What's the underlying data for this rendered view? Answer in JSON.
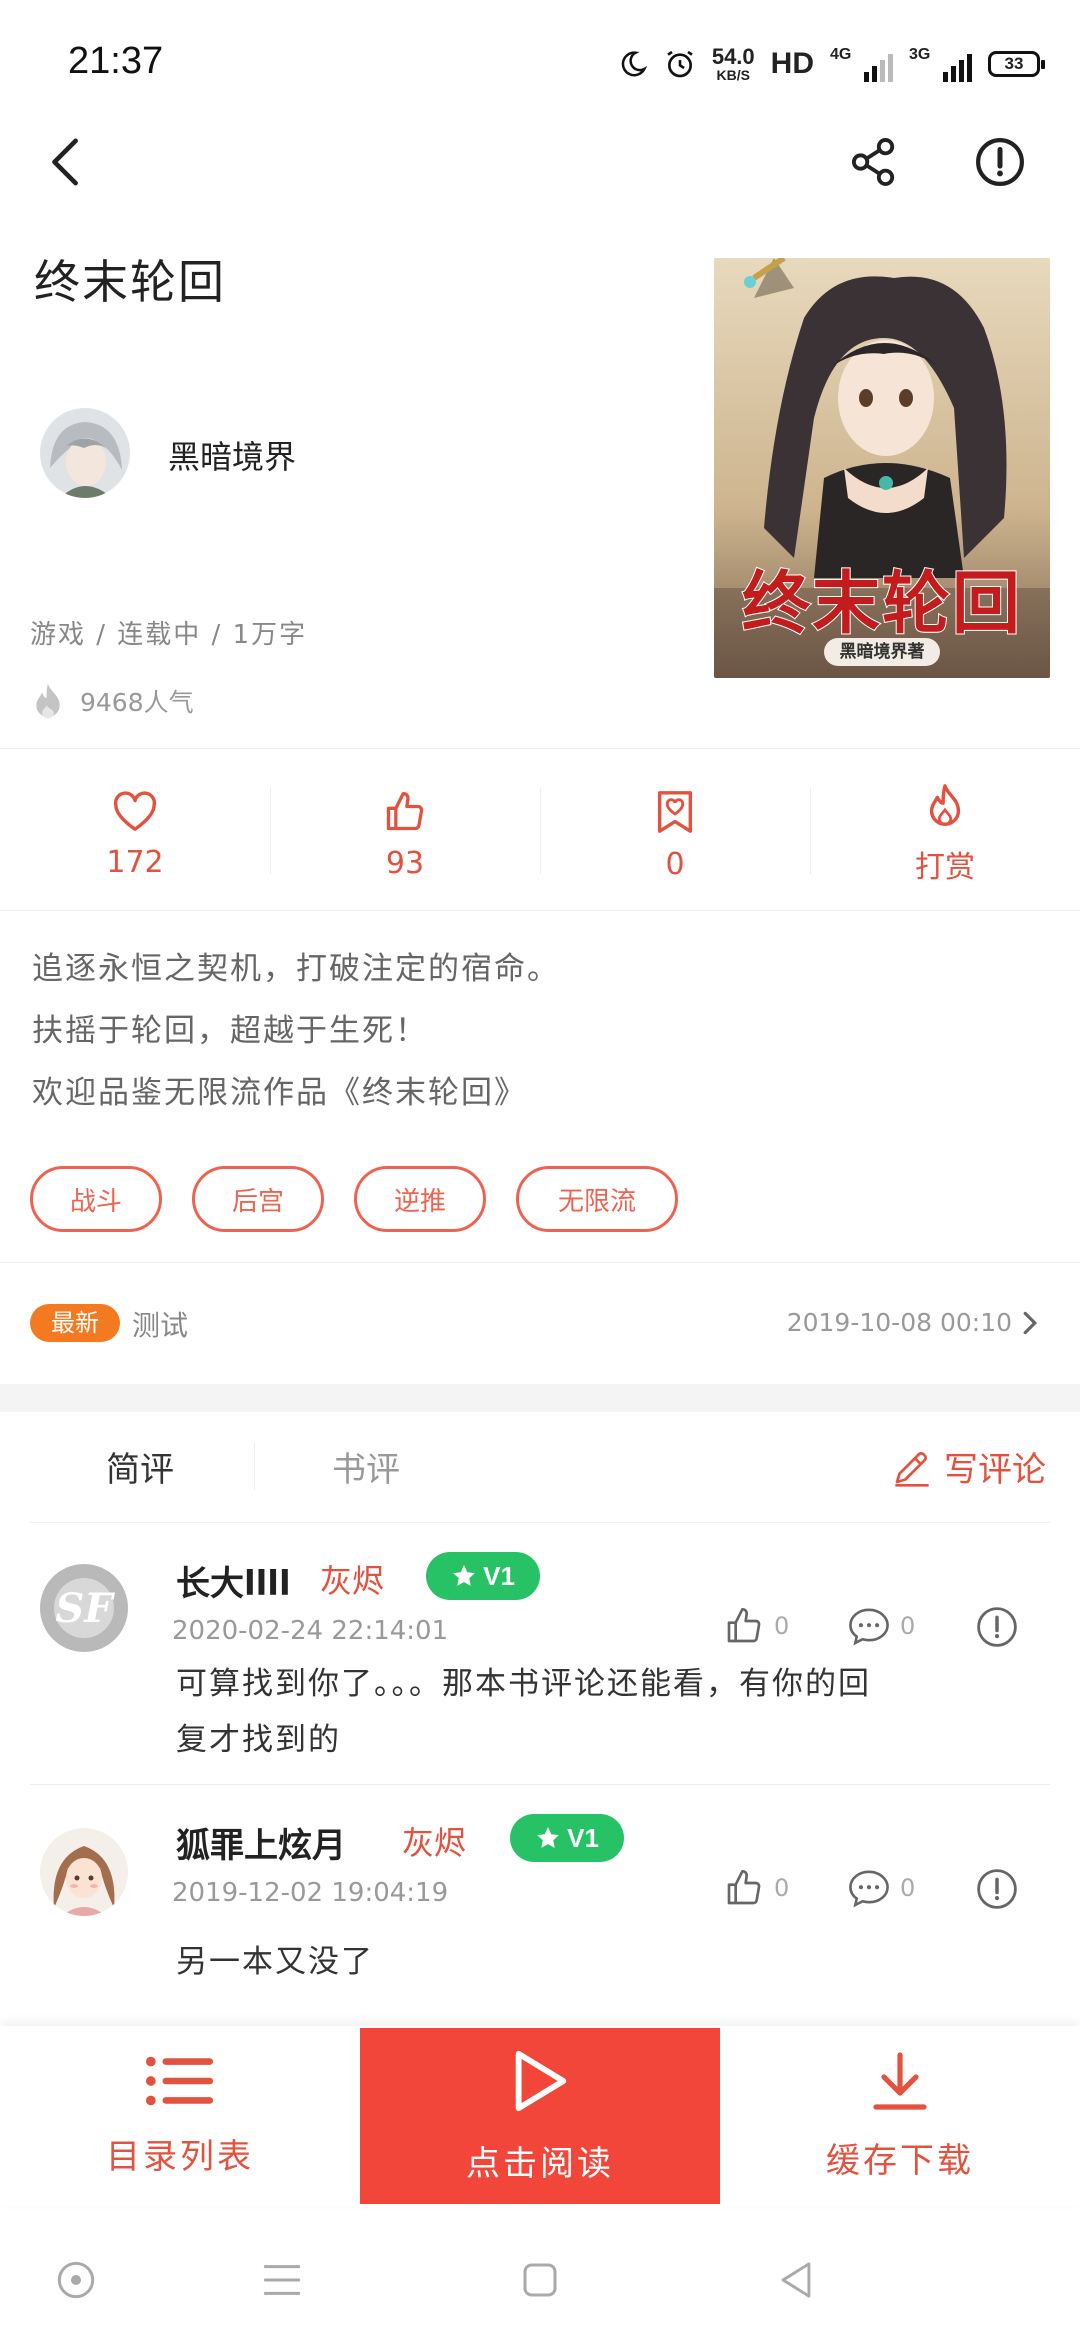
{
  "status_bar": {
    "time": "21:37",
    "net_speed": "54.0",
    "net_unit": "KB/S",
    "hd": "HD",
    "sim1": "4G",
    "sim2": "3G",
    "battery": "33"
  },
  "book": {
    "title": "终末轮回",
    "author": "黑暗境界",
    "meta": "游戏 / 连载中 / 1万字",
    "popularity": "9468人气",
    "cover_title": "终末轮回",
    "cover_subtitle": "黑暗境界著"
  },
  "stats": {
    "favorites": "172",
    "likes": "93",
    "bookmarks": "0",
    "reward_label": "打赏"
  },
  "description": [
    "追逐永恒之契机，打破注定的宿命。",
    "扶摇于轮回，超越于生死！",
    "欢迎品鉴无限流作品《终末轮回》"
  ],
  "tags": [
    "战斗",
    "后宫",
    "逆推",
    "无限流"
  ],
  "latest": {
    "badge": "最新",
    "chapter": "测试",
    "date": "2019-10-08 00:10"
  },
  "review_tabs": {
    "short_review": "简评",
    "book_review": "书评",
    "write_comment": "写评论"
  },
  "comments": [
    {
      "user": "长大llll",
      "level": "灰烬",
      "vip": "1",
      "date": "2020-02-24 22:14:01",
      "likes": "0",
      "replies": "0",
      "text_lines": [
        "可算找到你了。。。那本书评论还能看，有你的回",
        "复才找到的"
      ]
    },
    {
      "user": "狐罪上炫月",
      "level": "灰烬",
      "vip": "1",
      "date": "2019-12-02 19:04:19",
      "likes": "0",
      "replies": "0",
      "text_lines": [
        "另一本又没了"
      ]
    }
  ],
  "bottom_actions": {
    "toc": "目录列表",
    "read": "点击阅读",
    "download": "缓存下载"
  },
  "colors": {
    "accent": "#e2523f",
    "read_button": "#f2463a",
    "latest_badge": "#f47a22",
    "vip_badge": "#27c266"
  }
}
